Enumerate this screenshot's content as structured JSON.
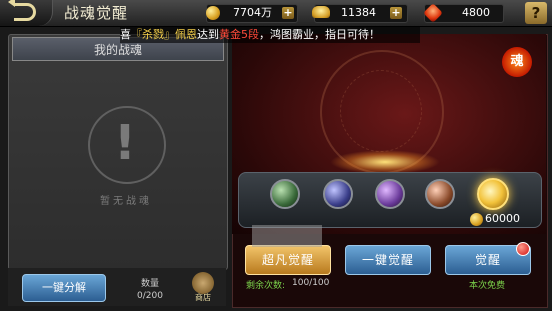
{
  "header": {
    "title": "战魂觉醒",
    "gold": "7704万",
    "ingot": "11384",
    "energy": "4800",
    "help": "?"
  },
  "marquee": {
    "part1": "喜",
    "name": "『杀戮』佩恩",
    "part2": "达到",
    "rank": "黄金5段",
    "part3": "，鸿图霸业，指日可待！"
  },
  "left": {
    "title": "我的战魂",
    "empty_text": "暂无战魂",
    "decompose": "一键分解",
    "qty_label": "数量",
    "qty_value": "0/200",
    "shop_label": "商店"
  },
  "right": {
    "soul_badge": "魂",
    "cost": "60000",
    "super_awaken": "超凡觉醒",
    "onekey_awaken": "一键觉醒",
    "awaken": "觉醒",
    "remain_label": "剩余次数:",
    "remain_value": "100/100",
    "free_text": "本次免费"
  }
}
